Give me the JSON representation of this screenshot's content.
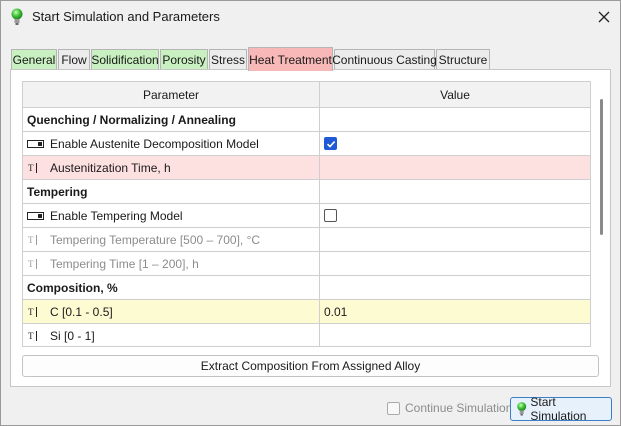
{
  "window": {
    "title": "Start Simulation and Parameters",
    "close_icon": "close-icon"
  },
  "tabs": [
    {
      "label": "General",
      "color": "#c8f0c0"
    },
    {
      "label": "Flow",
      "color": "#ececec"
    },
    {
      "label": "Solidification",
      "color": "#c8f0c0"
    },
    {
      "label": "Porosity",
      "color": "#c8f0c0"
    },
    {
      "label": "Stress",
      "color": "#ececec"
    },
    {
      "label": "Heat Treatment",
      "color": "#f8b8b8",
      "active": true
    },
    {
      "label": "Continuous Casting",
      "color": "#ececec"
    },
    {
      "label": "Structure",
      "color": "#ececec"
    }
  ],
  "table": {
    "headers": {
      "parameter": "Parameter",
      "value": "Value"
    },
    "rows": [
      {
        "type": "section",
        "label": "Quenching / Normalizing / Annealing",
        "value": ""
      },
      {
        "type": "checkbox",
        "label": "Enable Austenite Decomposition Model",
        "checked": true
      },
      {
        "type": "text",
        "label": "Austenitization Time, h",
        "value": "",
        "highlight": "pink"
      },
      {
        "type": "section",
        "label": "Tempering",
        "value": ""
      },
      {
        "type": "checkbox",
        "label": "Enable Tempering Model",
        "checked": false
      },
      {
        "type": "text",
        "label": "Tempering Temperature [500 – 700], °C",
        "value": "",
        "disabled": true
      },
      {
        "type": "text",
        "label": "Tempering Time [1 – 200], h",
        "value": "",
        "disabled": true
      },
      {
        "type": "section",
        "label": "Composition, %",
        "value": ""
      },
      {
        "type": "text",
        "label": "C [0.1 - 0.5]",
        "value": "0.01",
        "highlight": "yellow"
      },
      {
        "type": "text",
        "label": "Si [0 - 1]",
        "value": ""
      }
    ]
  },
  "buttons": {
    "extract": "Extract Composition From Assigned Alloy",
    "continue": "Continue Simulation",
    "start": "Start Simulation"
  },
  "icons": {
    "app": "green-bulb-icon",
    "checkbox_row": "toggle-field-icon",
    "text_row": "text-field-icon"
  },
  "colors": {
    "pink_row": "#fde0e0",
    "yellow_row": "#fdfbd2",
    "checkbox_checked": "#1f5bd6",
    "start_border": "#3c7fc7"
  }
}
